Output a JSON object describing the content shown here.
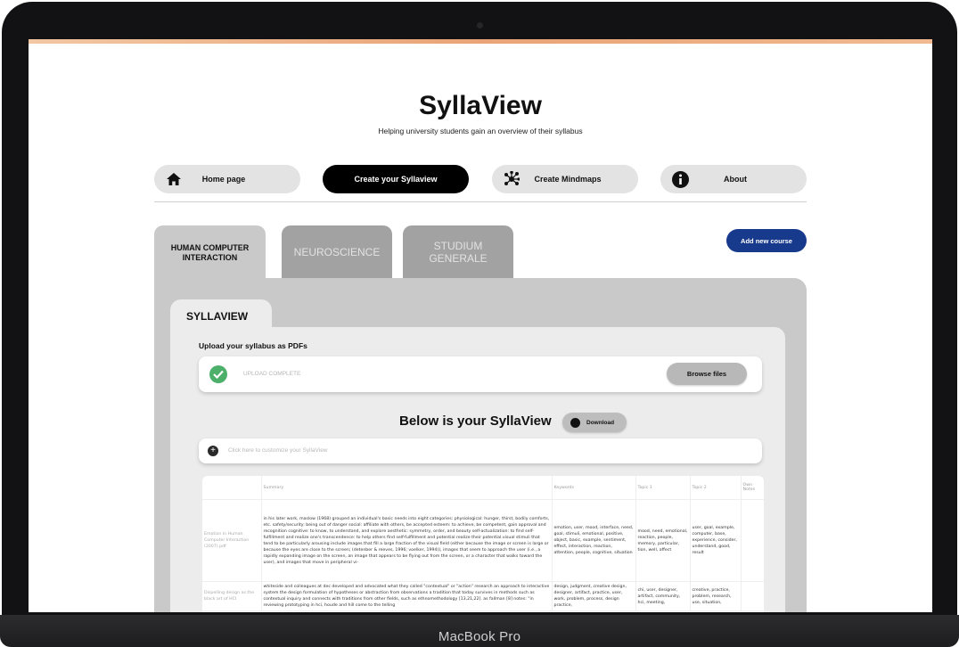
{
  "device": {
    "label": "MacBook Pro"
  },
  "header": {
    "title": "SyllaView",
    "subtitle": "Helping university students gain an overview of their syllabus"
  },
  "nav": {
    "home": "Home page",
    "create": "Create your Syllaview",
    "mindmaps": "Create Mindmaps",
    "about": "About"
  },
  "courses": {
    "tabs": [
      "HUMAN COMPUTER INTERACTION",
      "NEUROSCIENCE",
      "STUDIUM GENERALE"
    ],
    "add_button": "Add new course"
  },
  "syllaview": {
    "section_tab": "SYLLAVIEW",
    "upload_label": "Upload your syllabus as PDFs",
    "upload_status": "UPLOAD COMPLETE",
    "browse_button": "Browse files",
    "result_title": "Below is your SyllaView",
    "download_button": "Download",
    "customize_text": "Click here to customize your SyllaView"
  },
  "table": {
    "headers": [
      "",
      "Summary",
      "Keywords",
      "Topic 1",
      "Topic 2",
      "Own Notes"
    ],
    "rows": [
      {
        "file": "Emotion in Human Computer Interaction (2007).pdf",
        "summary": "in his later work, maslow (1968) grouped an individual's basic needs into eight categories: physiological: hunger, thirst, bodily comforts, etc. safety/security: being out of danger social: affiliate with others, be accepted esteem: to achieve, be competent, gain approval and recognition cognitive: to know, to understand, and explore aesthetic: symmetry, order, and beauty self-actualization: to find self-fulfillment and realize one's transcendence: to help others find self-fulfillment and potential realize their potential.visual stimuli that tend to be particularly arousing include images that fill a large fraction of the visual field (either because the image or screen is large or because the eyes are close to the screen; (detenber & reeves, 1996; voelker, 1994)), images that seem to approach the user (i.e., a rapidly expanding image on the screen, an image that appears to be flying out from the screen, or a character that walks toward the user), and images that move in peripheral vi-",
        "keywords": "emotion, user, mood, interface, need, goal, stimuli, emotional, positive, object, basic, example, sentiment, effect, interaction, reaction, attention, people, cognitive, situation",
        "topic1": "mood, need, emotional, reaction, people, memory, particular, tion, well, affect",
        "topic2": "user, goal, example, computer, base, experience, consider, understand, good, result",
        "notes": ""
      },
      {
        "file": "Dispelling design as the black art of HCI",
        "summary": "whiteside and colleagues at dec developed and advocated what they called \"contextual\" or \"action\" research an approach to interactive system the design formulation of hypotheses or abstraction from observations a tradition that today survives in methods such as contextual inquiry and connects with traditions from other fields, such as ethnomethodology [13,21,22]. as fallman [8] notes: \"in reviewing prototyping in hci, houde and hill come to the telling",
        "keywords": "design, judgment, creative design, designer, artifact, practice, user, work, problem, process, design practice,",
        "topic1": "chi, user, designer, artifact, community, hci, meeting,",
        "topic2": "creative, practice, problem, research, use, situation,",
        "notes": ""
      }
    ]
  }
}
